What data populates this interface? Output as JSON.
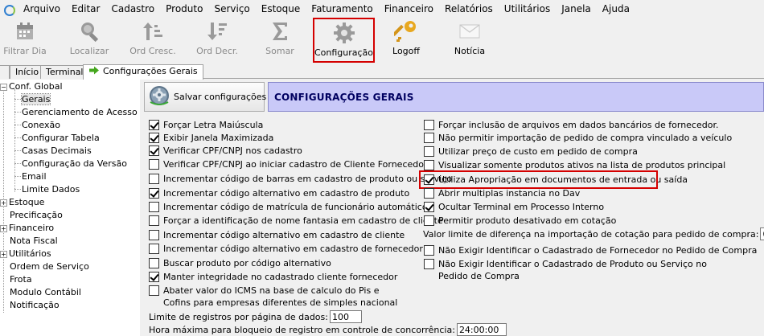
{
  "menu": [
    "Arquivo",
    "Editar",
    "Cadastro",
    "Produto",
    "Serviço",
    "Estoque",
    "Faturamento",
    "Financeiro",
    "Relatórios",
    "Utilitários",
    "Janela",
    "Ajuda"
  ],
  "toolbar": {
    "filtrar_dia": "Filtrar Dia",
    "localizar": "Localizar",
    "ord_cresc": "Ord Cresc.",
    "ord_decr": "Ord Decr.",
    "somar": "Somar",
    "configuracao": "Configuração",
    "logoff": "Logoff",
    "noticia": "Notícia"
  },
  "tabs": {
    "inicio": "Início",
    "terminal": "Terminal",
    "config": "Configurações Gerais"
  },
  "tree": {
    "conf_global": "Conf. Global",
    "gerais": "Gerais",
    "gerenciamento": "Gerenciamento de Acesso",
    "conexao": "Conexão",
    "configurar_tabela": "Configurar Tabela",
    "casas_decimais": "Casas Decimais",
    "config_versao": "Configuração da Versão",
    "email": "Email",
    "limite_dados": "Limite Dados",
    "estoque": "Estoque",
    "precificacao": "Precificação",
    "financeiro": "Financeiro",
    "nota_fiscal": "Nota Fiscal",
    "utilitarios": "Utilitários",
    "ordem_servico": "Ordem de Serviço",
    "frota": "Frota",
    "modulo_contabil": "Modulo Contábil",
    "notificacao": "Notificação"
  },
  "content": {
    "save_label": "Salvar configurações",
    "section_title": "CONFIGURAÇÕES GERAIS",
    "left_options": [
      {
        "label": "Forçar Letra Maiúscula",
        "checked": true
      },
      {
        "label": "Exibir Janela Maximizada",
        "checked": true
      },
      {
        "label": "Verificar CPF/CNPJ nos cadastro",
        "checked": true
      },
      {
        "label": "Verificar CPF/CNPJ ao iniciar cadastro de Cliente Fornecedor",
        "checked": false
      },
      {
        "label": "Incrementar código de barras em cadastro de produto ou serviço",
        "checked": false
      },
      {
        "label": "Incrementar código alternativo em cadastro de produto",
        "checked": true
      },
      {
        "label": "Incrementar código de matrícula de funcionário automático",
        "checked": false
      },
      {
        "label": "Forçar a identificação de nome fantasia em cadastro de cliente",
        "checked": false
      },
      {
        "label": "Incrementar código alternativo em cadastro de  cliente",
        "checked": false
      },
      {
        "label": "Incrementar código alternativo em cadastro de  fornecedor",
        "checked": false
      },
      {
        "label": "Buscar produto por código alternativo",
        "checked": false
      },
      {
        "label": "Manter integridade no cadastrado cliente fornecedor",
        "checked": true
      },
      {
        "label": "Abater valor do ICMS na base de calculo do Pis e Cofins para empresas diferentes de simples nacional",
        "checked": false
      }
    ],
    "right_options": [
      {
        "label": "Forçar inclusão de arquivos em dados bancários de fornecedor.",
        "checked": false
      },
      {
        "label": "Não permitir importação de pedido de compra vinculado a veículo",
        "checked": false
      },
      {
        "label": "Utilizar preço de custo em pedido de compra",
        "checked": false
      },
      {
        "label": "Visualizar somente produtos ativos na lista de produtos principal",
        "checked": false
      },
      {
        "label": "Utiliza Apropriação em documentos de entrada ou saída",
        "checked": true
      },
      {
        "label": "Abrir multiplas instancia no Dav",
        "checked": false
      },
      {
        "label": "Ocultar Terminal em Processo Interno",
        "checked": true
      },
      {
        "label": "Permitir produto desativado em cotação",
        "checked": false
      }
    ],
    "valor_limite_label": "Valor limite de diferença na importação de cotação para pedido de compra:",
    "valor_limite_value": "0,00",
    "right_options_b": [
      {
        "label": "Não Exigir Identificar o Cadastrado  de Fornecedor no Pedido de Compra",
        "checked": false
      },
      {
        "label": "Não Exigir Identificar o Cadastrado  de Produto ou Serviço no Pedido de Compra",
        "checked": false
      }
    ],
    "limite_registros_label": "Limite de registros por página de dados:",
    "limite_registros_value": "100",
    "hora_maxima_label": "Hora máxima para bloqueio de registro em controle de concorrência:",
    "hora_maxima_value": "24:00:00"
  }
}
